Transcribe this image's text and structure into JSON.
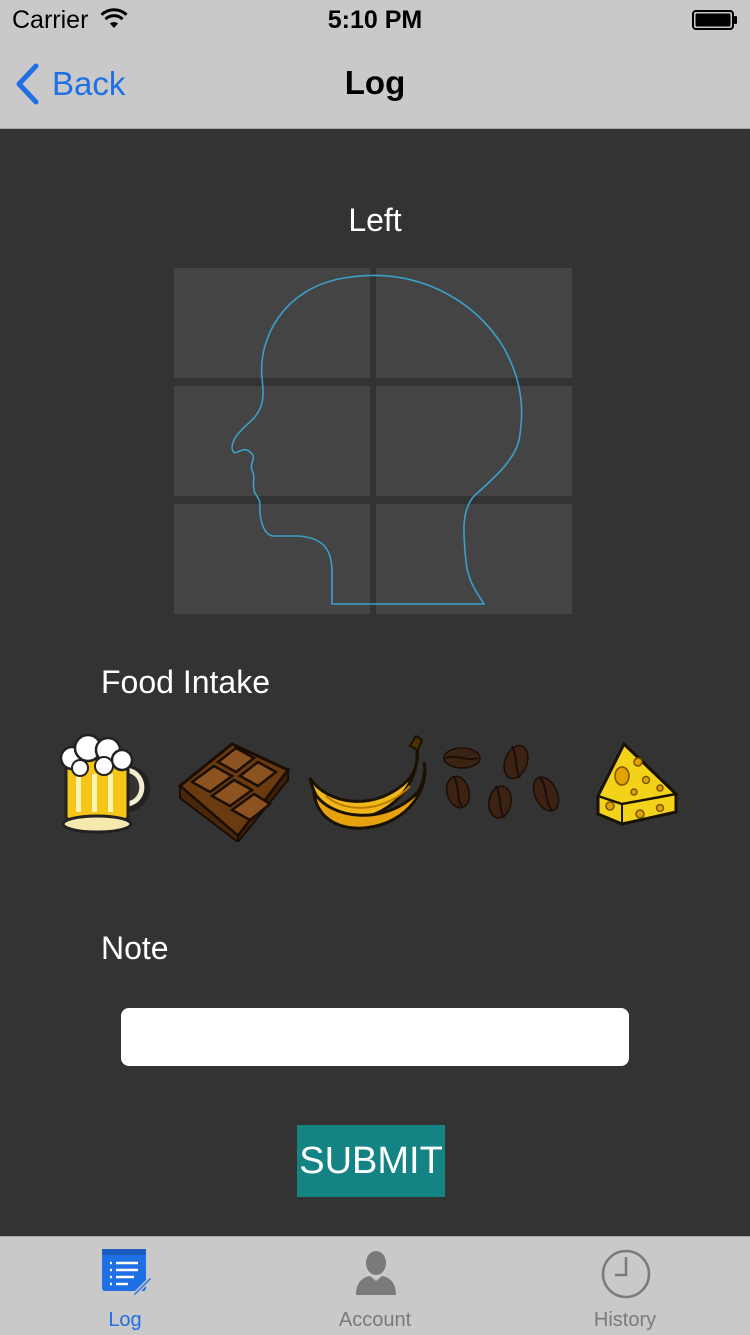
{
  "status_bar": {
    "carrier": "Carrier",
    "time": "5:10 PM"
  },
  "nav": {
    "back_label": "Back",
    "title": "Log"
  },
  "head_diagram": {
    "side_label": "Left",
    "outline_color": "#3aa0c8",
    "grid_cells": [
      "top-back",
      "top-front",
      "middle-back",
      "middle-front",
      "bottom-back",
      "bottom-front"
    ]
  },
  "food": {
    "section_label": "Food Intake",
    "items": [
      {
        "name": "beer",
        "icon": "beer-mug-icon"
      },
      {
        "name": "chocolate",
        "icon": "chocolate-bar-icon"
      },
      {
        "name": "banana",
        "icon": "banana-icon"
      },
      {
        "name": "coffee",
        "icon": "coffee-beans-icon"
      },
      {
        "name": "cheese",
        "icon": "cheese-icon"
      }
    ]
  },
  "note": {
    "section_label": "Note",
    "value": "",
    "placeholder": ""
  },
  "submit": {
    "label": "SUBMIT",
    "color": "#148383"
  },
  "tab_bar": {
    "active_color": "#1f6fe5",
    "inactive_color": "#7a7a7a",
    "tabs": [
      {
        "label": "Log",
        "icon": "log-list-icon",
        "active": true
      },
      {
        "label": "Account",
        "icon": "person-icon",
        "active": false
      },
      {
        "label": "History",
        "icon": "clock-icon",
        "active": false
      }
    ]
  }
}
